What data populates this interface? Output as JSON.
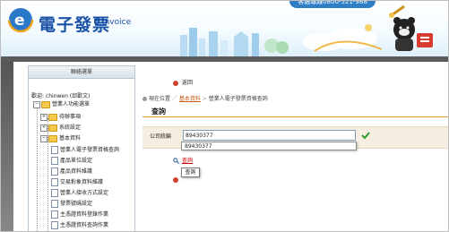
{
  "header": {
    "logo_title": "電子發票",
    "logo_subtitle": "E-Invoice",
    "hotline": "客服專線0800-521-988"
  },
  "sidebar": {
    "title": "聯絡選單",
    "welcome": "歡迎: chinwen (邱歡文)",
    "root": "營業人功能選單",
    "items": [
      {
        "label": "待辦事項"
      },
      {
        "label": "系統設定"
      },
      {
        "label": "基本資料"
      },
      {
        "label": "營業人電子發票資格查詢"
      },
      {
        "label": "產品單位設定"
      },
      {
        "label": "產品資料維護"
      },
      {
        "label": "交易對象資料維護"
      },
      {
        "label": "營業人接收方式設定"
      },
      {
        "label": "發票號碼設定"
      },
      {
        "label": "主憑證資料登錄作業"
      },
      {
        "label": "主憑證資料查詢作業"
      }
    ]
  },
  "main": {
    "back_label": "返回",
    "breadcrumb": {
      "prefix": "現在位置",
      "link": "基本資料",
      "current": "營業人電子發票資格查詢"
    },
    "section_title": "查詢",
    "form": {
      "label": "公司統編",
      "value": "89430377"
    },
    "autocomplete_option": "89430377",
    "search_link": "查詢",
    "tooltip": "查詢"
  }
}
